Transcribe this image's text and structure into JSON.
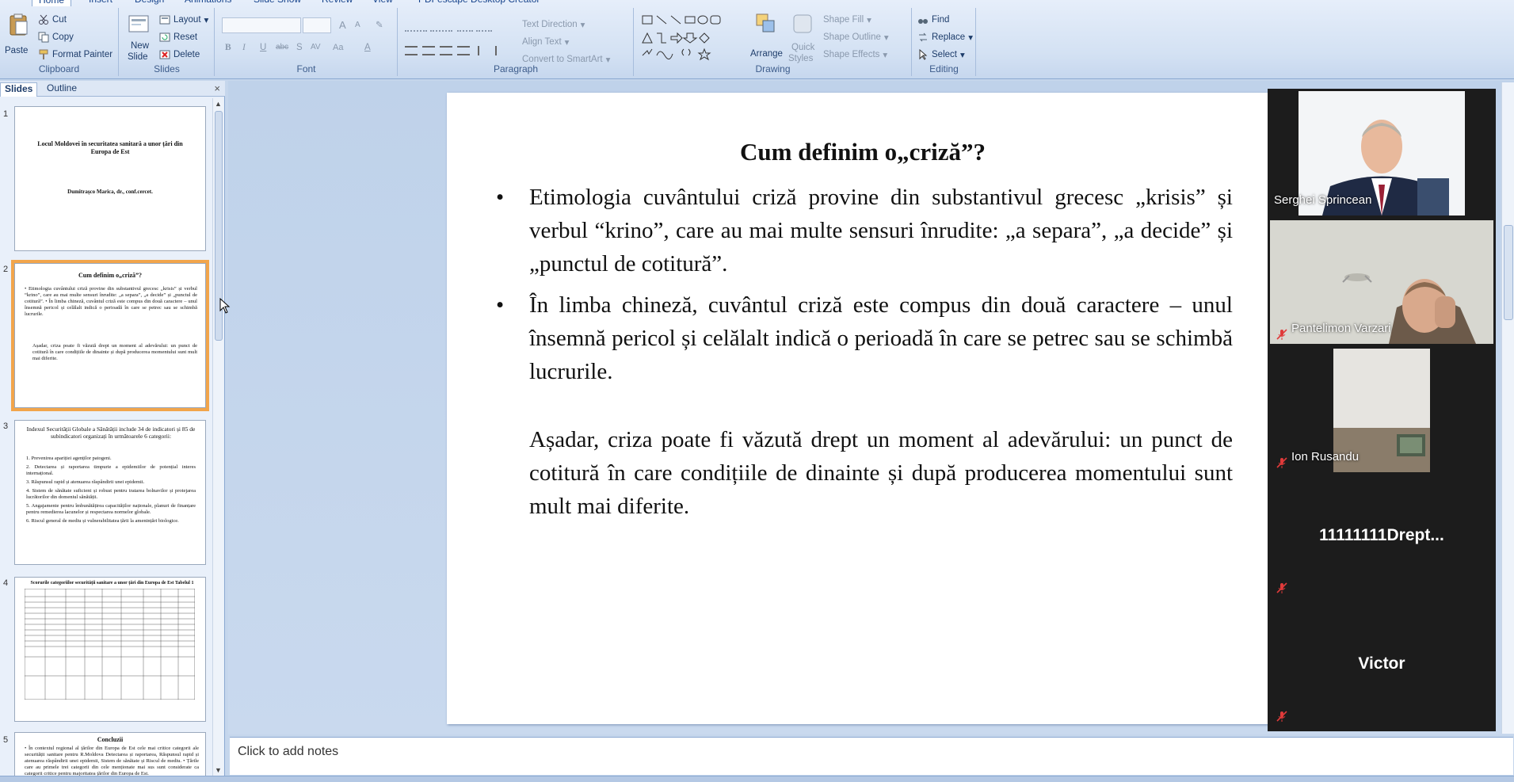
{
  "ribbon": {
    "tabs": [
      "Home",
      "Insert",
      "Design",
      "Animations",
      "Slide Show",
      "Review",
      "View",
      "PDFescape Desktop Creator"
    ],
    "clipboard": {
      "paste": "Paste",
      "cut": "Cut",
      "copy": "Copy",
      "format_painter": "Format Painter",
      "label": "Clipboard"
    },
    "slides": {
      "new_slide_1": "New",
      "new_slide_2": "Slide",
      "layout": "Layout",
      "reset": "Reset",
      "delete": "Delete",
      "label": "Slides"
    },
    "font": {
      "label": "Font",
      "bold": "B",
      "italic": "I",
      "underline": "U",
      "strike": "abc",
      "shadow": "S",
      "spacing": "AV",
      "case": "Aa",
      "color": "A",
      "grow": "A",
      "shrink": "A"
    },
    "paragraph": {
      "text_direction": "Text Direction",
      "align_text": "Align Text",
      "smartart": "Convert to SmartArt",
      "label": "Paragraph"
    },
    "drawing": {
      "arrange": "Arrange",
      "quick_styles_1": "Quick",
      "quick_styles_2": "Styles",
      "shape_fill": "Shape Fill",
      "shape_outline": "Shape Outline",
      "shape_effects": "Shape Effects",
      "label": "Drawing"
    },
    "editing": {
      "find": "Find",
      "replace": "Replace",
      "select": "Select",
      "label": "Editing"
    }
  },
  "pane": {
    "tabs": [
      "Slides",
      "Outline"
    ],
    "close": "×",
    "thumbnails": [
      {
        "num": "1",
        "title": "Locul Moldovei în securitatea sanitară a unor țări din Europa de Est",
        "author": "Dumitrașco Marica, dr., conf.cercet."
      },
      {
        "num": "2",
        "title": "Cum definim o„criză”?",
        "body": "• Etimologia cuvântului criză provine din substantivul grecesc „krisis” și verbul “krino”, care au mai multe sensuri înrudite: „a separa”, „a decide” și „punctul de cotitură”. • În limba chineză, cuvântul criză este compus din două caractere – unul însemnă pericol și celălalt indică o perioadă în care se petrec sau se schimbă lucrurile.",
        "body2": "Așadar, criza poate fi văzută drept un moment al adevărului: un punct de cotitură în care condițiile de dinainte și după producerea momentului sunt mult mai diferite."
      },
      {
        "num": "3",
        "title": "Indexul Securității Globale a Sănătății include 34 de indicatori și 85 de subindicatori organizați în următoarele 6 categorii:",
        "items": [
          "1. Prevenirea apariției agenților patogeni.",
          "2. Detectarea și raportarea timpurie a epidemiilor de potențial interes internațional.",
          "3. Răspunsul rapid și atenuarea răspândirii unei epidemii.",
          "4. Sistem de sănătate suficient și robust pentru tratarea bolnavilor și protejarea lucrătorilor din domeniul sănătății.",
          "5. Angajamente pentru îmbunătățirea capacităților naționale, planuri de finanțare pentru remedierea lacunelor și respectarea normelor globale.",
          "6. Riscul general de mediu și vulnerabilitatea țării la amenințări biologice."
        ]
      },
      {
        "num": "4",
        "title": "Scorurile categoriilor securității sanitare a unor țări din Europa de Est     Tabelul 1"
      },
      {
        "num": "5",
        "title": "Concluzii",
        "body": "• În contextul regional al țărilor din Europa de Est cele mai critice categorii ale securității sanitare pentru R.Moldova Detectarea și raportarea, Răspunsul rapid și atenuarea răspândirii unei epidemii, Sistem de sănătate și Riscul de mediu. • Țările care au primele trei categorii din cele menționate mai sus sunt considerate ca categorii critice pentru majoritatea țărilor din Europa de Est."
      }
    ]
  },
  "slide": {
    "title": "Cum definim o„criză”?",
    "bullet_char": "•",
    "p1": "Etimologia cuvântului criză provine din substantivul grecesc „krisis” și verbul “krino”, care au mai multe sensuri înrudite: „a separa”, „a decide” și „punctul de cotitură”.",
    "p2": "În limba chineză, cuvântul criză este compus din două caractere – unul însemnă pericol și celălalt indică o perioadă în care se petrec sau se schimbă lucrurile.",
    "p3": "Așadar, criza poate fi văzută drept un moment al adevărului: un punct de cotitură în care condițiile de dinainte și după producerea momentului sunt mult mai diferite."
  },
  "notes": {
    "placeholder": "Click to add notes"
  },
  "participants": [
    {
      "name": "Serghei Sprincean",
      "muted": false,
      "video": true
    },
    {
      "name": "Pantelimon Varzari",
      "muted": true,
      "video": true
    },
    {
      "name": "Ion Rusandu",
      "muted": true,
      "video": true
    },
    {
      "name": "11111111Drept...",
      "muted": true,
      "video": false
    },
    {
      "name": "Victor",
      "muted": true,
      "video": false
    }
  ],
  "colors": {
    "ribbon": "#d3e1f3",
    "accent": "#f2a54b",
    "mute": "#e03a3a",
    "video_bg": "#1c1c1c"
  },
  "icons": [
    "paste-icon",
    "scissors-icon",
    "copy-icon",
    "brush-icon",
    "layout-icon",
    "reset-icon",
    "delete-icon",
    "binoculars-icon",
    "replace-icon",
    "cursor-icon",
    "mic-muted-icon"
  ]
}
